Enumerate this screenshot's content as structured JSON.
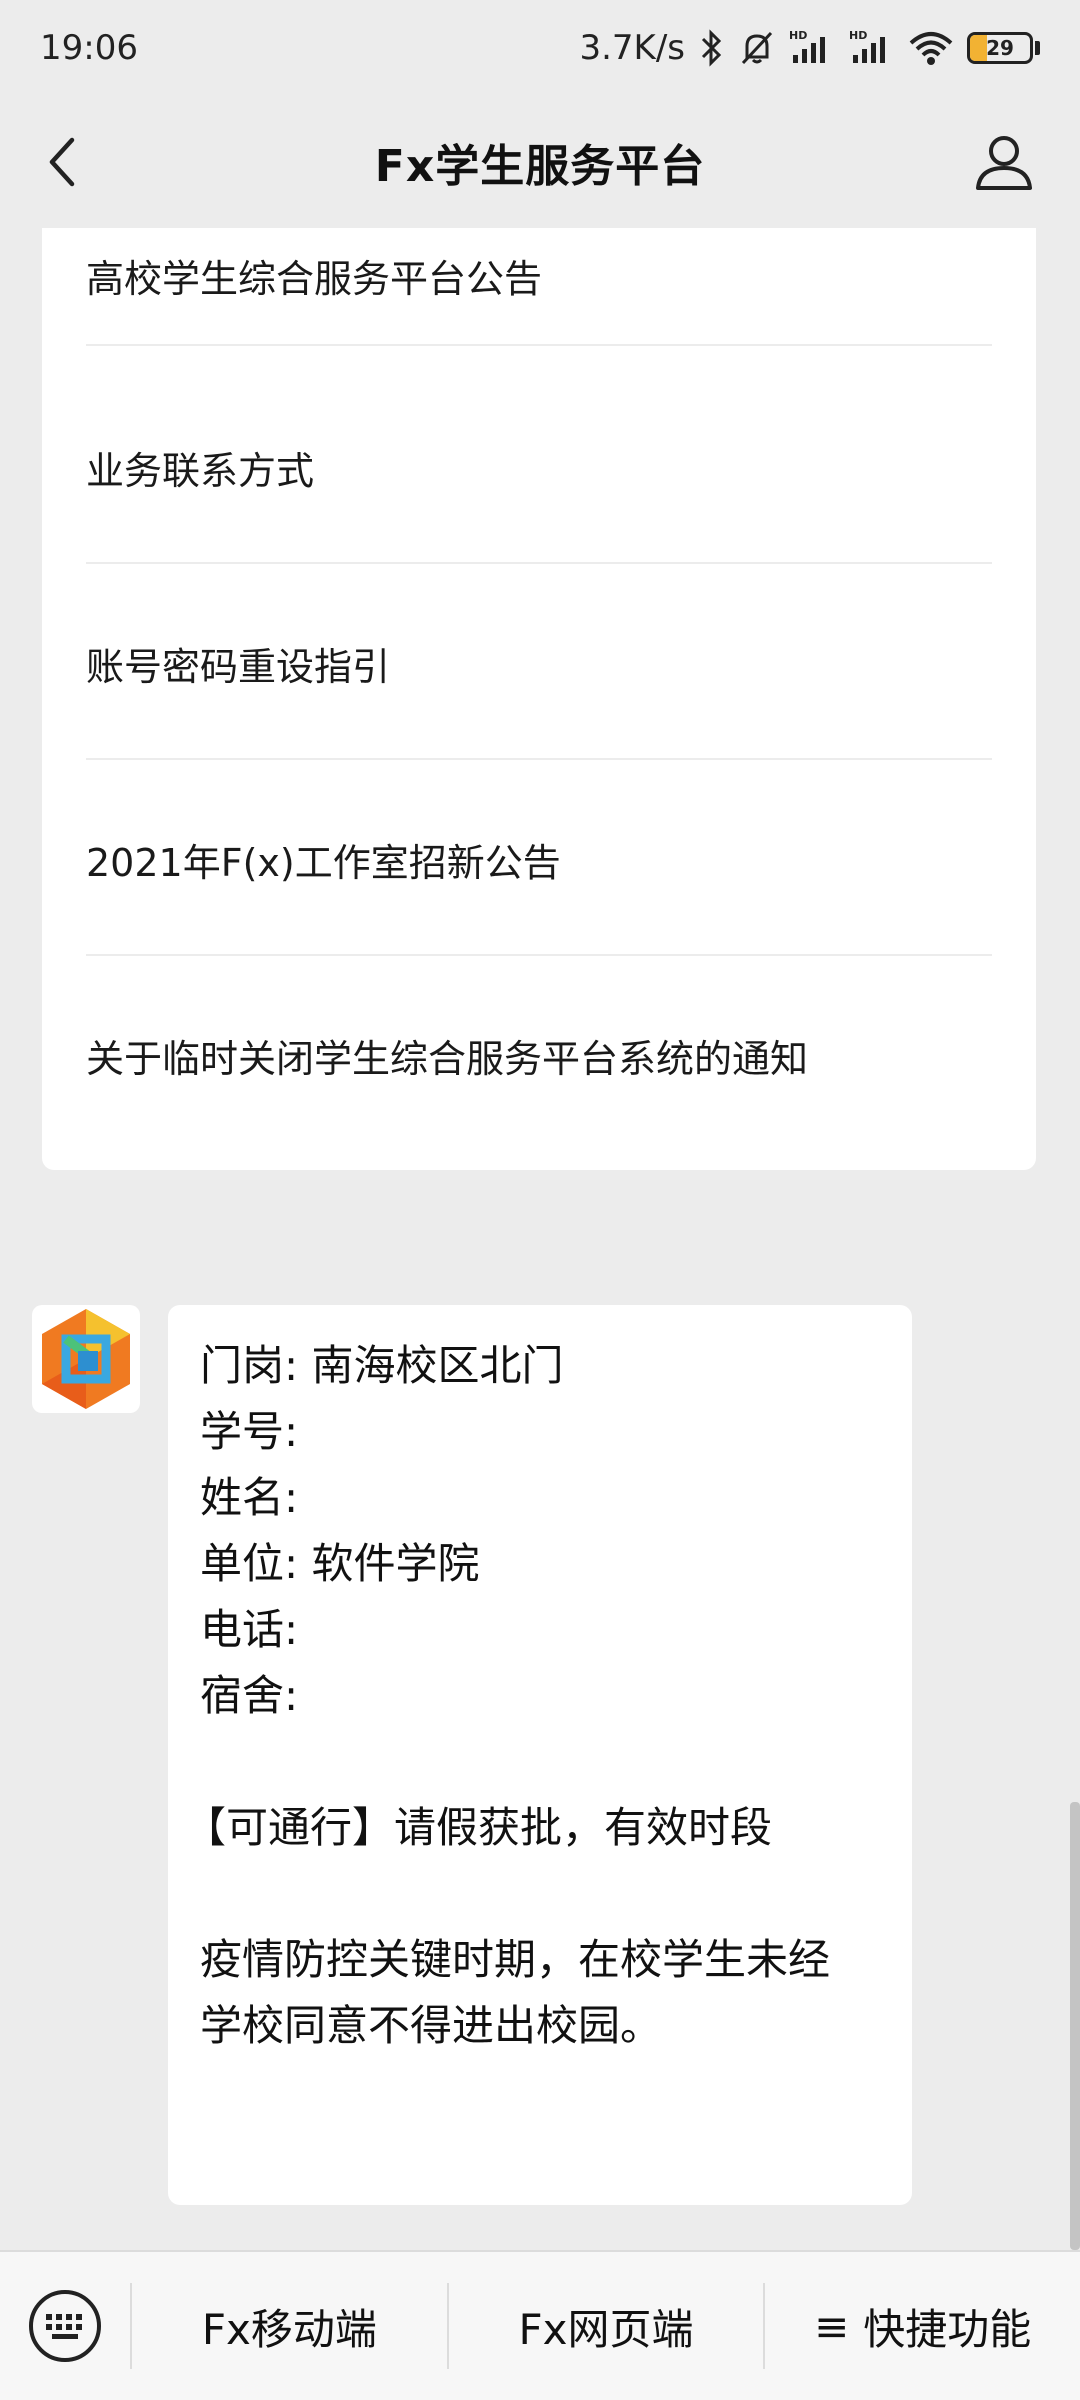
{
  "status_bar": {
    "time": "19:06",
    "net_speed": "3.7K/s",
    "battery": "29",
    "battery_level": 0.29,
    "icons": [
      "bluetooth-icon",
      "mute-bell-icon",
      "signal-hd-icon",
      "signal-hd-icon",
      "wifi-icon",
      "battery-icon"
    ]
  },
  "header": {
    "title": "Fx学生服务平台",
    "back_icon": "back-chevron-icon",
    "profile_icon": "user-profile-icon"
  },
  "notices": {
    "items": [
      {
        "label": "高校学生综合服务平台公告"
      },
      {
        "label": "业务联系方式"
      },
      {
        "label": "账号密码重设指引"
      },
      {
        "label": "2021年F(x)工作室招新公告"
      },
      {
        "label": "关于临时关闭学生综合服务平台系统的通知"
      }
    ]
  },
  "message": {
    "avatar_icon": "hexagon-logo-icon",
    "gate": "门岗: 南海校区北门",
    "student_id": "学号:",
    "name": "姓名:",
    "unit": "单位: 软件学院",
    "phone": "电话:",
    "dorm": "宿舍:",
    "status": "【可通行】请假获批，有效时段",
    "notice_line1": "疫情防控关键时期，在校学生未经",
    "notice_line2": "学校同意不得进出校园。"
  },
  "bottom_menu": {
    "keyboard_icon": "keyboard-icon",
    "items": [
      {
        "label": "Fx移动端",
        "prefix": ""
      },
      {
        "label": "Fx网页端",
        "prefix": ""
      },
      {
        "label": "快捷功能",
        "prefix": "≡"
      }
    ]
  },
  "colors": {
    "background": "#ececec",
    "card": "#ffffff",
    "battery_fill": "#f2b233",
    "logo_orange": "#f07a21",
    "logo_yellow": "#f5c12e",
    "logo_blue": "#3aa8e0",
    "logo_green": "#4cc27a"
  }
}
